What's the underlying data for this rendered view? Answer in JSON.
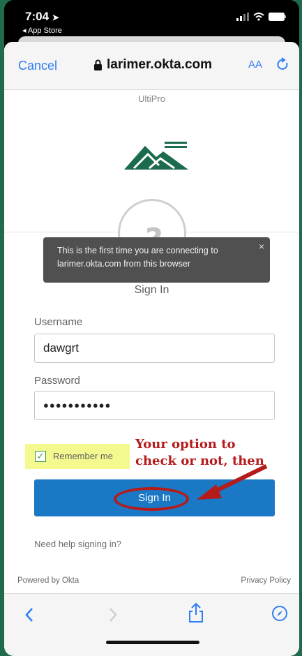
{
  "status_bar": {
    "time": "7:04",
    "back_app": "◂ App Store"
  },
  "browser": {
    "cancel": "Cancel",
    "domain": "larimer.okta.com",
    "text_size": "AA"
  },
  "page": {
    "app_label": "UltiPro",
    "tooltip": "This is the first time you are connecting to larimer.okta.com from this browser",
    "tooltip_close": "×",
    "title": "Sign In",
    "username_label": "Username",
    "username_value": "dawgrt",
    "password_label": "Password",
    "password_value": "●●●●●●●●●●●",
    "remember_label": "Remember me",
    "remember_checked": true,
    "signin_button": "Sign In",
    "help_link": "Need help signing in?",
    "powered_by": "Powered by Okta",
    "privacy": "Privacy Policy"
  },
  "annotation": {
    "line1": "Your option to",
    "line2": "check or not, then"
  },
  "toolbar": {
    "icons": [
      "back-icon",
      "forward-icon",
      "share-icon",
      "compass-icon"
    ]
  },
  "colors": {
    "accent": "#2f7df6",
    "button": "#1b78c5",
    "annotation": "#b51b1b",
    "highlight": "#f4f98f",
    "logo": "#1c6b4c"
  }
}
